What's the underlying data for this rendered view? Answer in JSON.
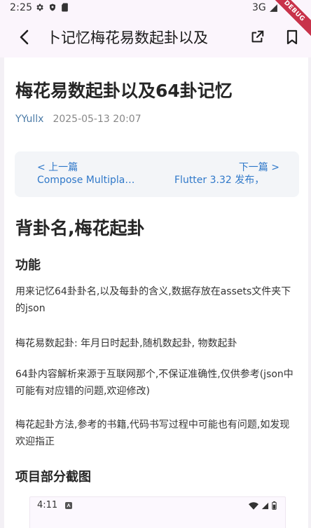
{
  "status_bar": {
    "time": "2:25",
    "network": "3G",
    "debug_label": "DEBUG"
  },
  "app_bar": {
    "title": "卜记忆梅花易数起卦以及"
  },
  "article": {
    "title": "梅花易数起卦以及64卦记忆",
    "author": "YYullx",
    "date": "2025-05-13 20:07",
    "nav": {
      "prev_label": "< 上一篇",
      "prev_title": "Compose Multiplatform 发布",
      "next_label": "下一篇 >",
      "next_title": "Flutter 3.32 发布，"
    },
    "section_title": "背卦名,梅花起卦",
    "features_heading": "功能",
    "paragraphs": [
      "用来记忆64卦卦名,以及每卦的含义,数据存放在assets文件夹下的json",
      "梅花易数起卦: 年月日时起卦,随机数起卦, 物数起卦",
      "64卦内容解析来源于互联网那个,不保证准确性,仅供参考(json中可能有对应错的问题,欢迎修改)",
      "梅花起卦方法,参考的书籍,代码书写过程中可能也有问题,如发现欢迎指正"
    ],
    "screenshots_heading": "项目部分截图",
    "preview_time": "4:11"
  },
  "colors": {
    "link": "#2f78c9",
    "author": "#4a7aa6",
    "ribbon": "#c8324a",
    "appbar_bg": "#fbf5fc"
  }
}
